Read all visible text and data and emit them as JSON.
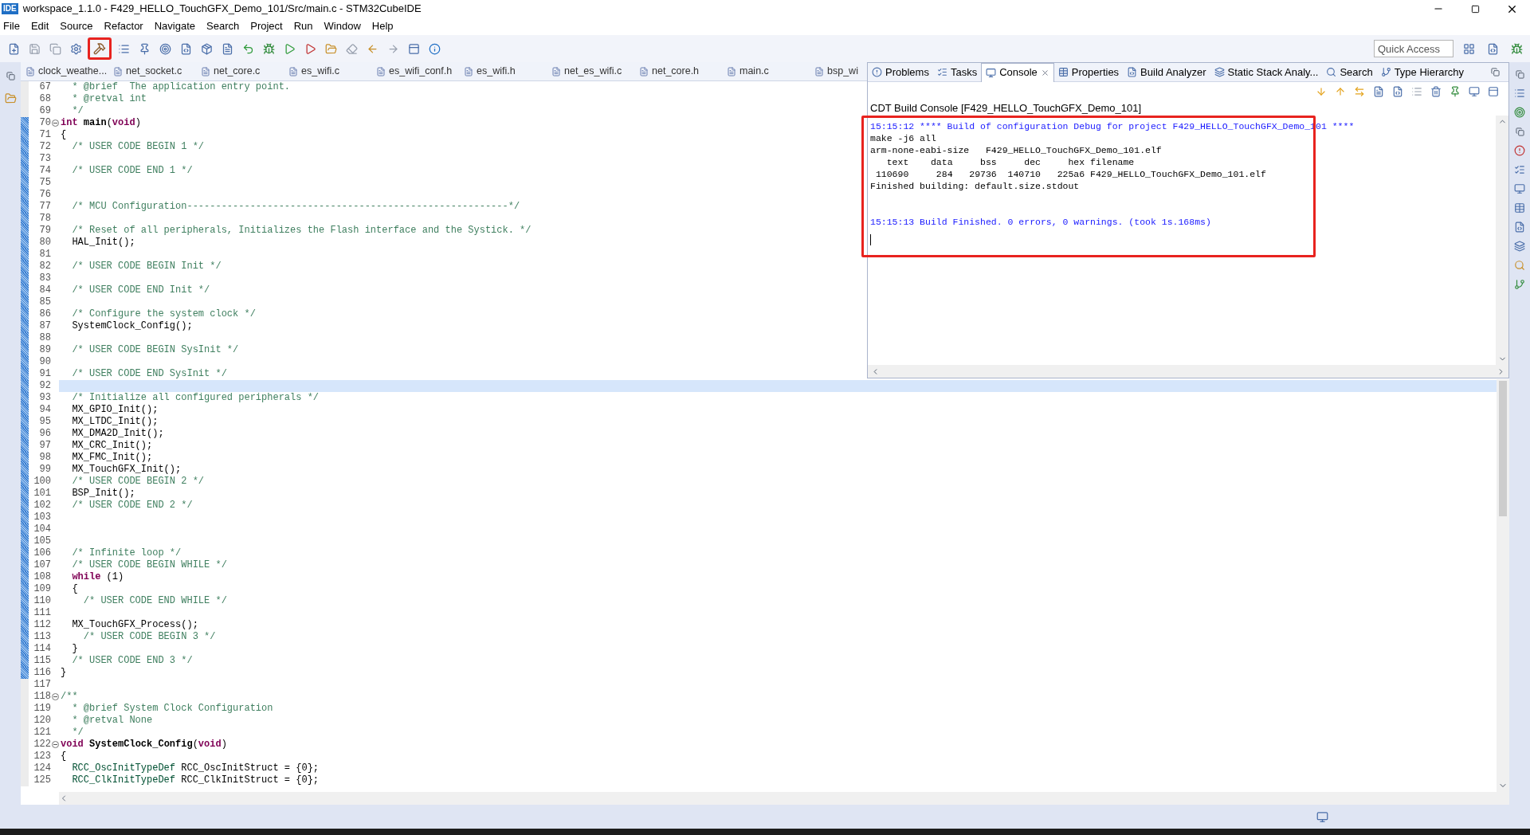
{
  "window": {
    "title": "workspace_1.1.0 - F429_HELLO_TouchGFX_Demo_101/Src/main.c - STM32CubeIDE",
    "app_badge": "IDE"
  },
  "menu": [
    "File",
    "Edit",
    "Source",
    "Refactor",
    "Navigate",
    "Search",
    "Project",
    "Run",
    "Window",
    "Help"
  ],
  "quick_access": {
    "placeholder": "Quick Access"
  },
  "editor_tabs": [
    "clock_weathe...",
    "net_socket.c",
    "net_core.c",
    "es_wifi.c",
    "es_wifi_conf.h",
    "es_wifi.h",
    "net_es_wifi.c",
    "net_core.h",
    "main.c",
    "bsp_wi"
  ],
  "lines": [
    {
      "n": "67",
      "changed": false,
      "current": false,
      "fold": false,
      "segs": [
        {
          "kind": "comment",
          "text": "  * @brief  The application entry point."
        }
      ]
    },
    {
      "n": "68",
      "changed": false,
      "current": false,
      "fold": false,
      "segs": [
        {
          "kind": "comment",
          "text": "  * @retval int"
        }
      ]
    },
    {
      "n": "69",
      "changed": false,
      "current": false,
      "fold": false,
      "segs": [
        {
          "kind": "comment",
          "text": "  */"
        }
      ]
    },
    {
      "n": "70",
      "changed": true,
      "current": false,
      "fold": true,
      "segs": [
        {
          "kind": "keyword",
          "text": "int "
        },
        {
          "kind": "bold",
          "text": "main"
        },
        {
          "kind": "plain",
          "text": "("
        },
        {
          "kind": "keyword",
          "text": "void"
        },
        {
          "kind": "plain",
          "text": ")"
        }
      ]
    },
    {
      "n": "71",
      "changed": true,
      "current": false,
      "fold": false,
      "segs": [
        {
          "kind": "plain",
          "text": "{"
        }
      ]
    },
    {
      "n": "72",
      "changed": true,
      "current": false,
      "fold": false,
      "segs": [
        {
          "kind": "comment",
          "text": "  /* USER CODE BEGIN 1 */"
        }
      ]
    },
    {
      "n": "73",
      "changed": true,
      "current": false,
      "fold": false
    },
    {
      "n": "74",
      "changed": true,
      "current": false,
      "fold": false,
      "segs": [
        {
          "kind": "comment",
          "text": "  /* USER CODE END 1 */"
        }
      ]
    },
    {
      "n": "75",
      "changed": true,
      "current": false,
      "fold": false
    },
    {
      "n": "76",
      "changed": true,
      "current": false,
      "fold": false
    },
    {
      "n": "77",
      "changed": true,
      "current": false,
      "fold": false,
      "segs": [
        {
          "kind": "comment",
          "text": "  /* MCU Configuration--------------------------------------------------------*/"
        }
      ]
    },
    {
      "n": "78",
      "changed": true,
      "current": false,
      "fold": false
    },
    {
      "n": "79",
      "changed": true,
      "current": false,
      "fold": false,
      "segs": [
        {
          "kind": "comment",
          "text": "  /* Reset of all peripherals, Initializes the Flash interface and the Systick. */"
        }
      ]
    },
    {
      "n": "80",
      "changed": true,
      "current": false,
      "fold": false,
      "segs": [
        {
          "kind": "plain",
          "text": "  HAL_Init();"
        }
      ]
    },
    {
      "n": "81",
      "changed": true,
      "current": false,
      "fold": false
    },
    {
      "n": "82",
      "changed": true,
      "current": false,
      "fold": false,
      "segs": [
        {
          "kind": "comment",
          "text": "  /* USER CODE BEGIN Init */"
        }
      ]
    },
    {
      "n": "83",
      "changed": true,
      "current": false,
      "fold": false
    },
    {
      "n": "84",
      "changed": true,
      "current": false,
      "fold": false,
      "segs": [
        {
          "kind": "comment",
          "text": "  /* USER CODE END Init */"
        }
      ]
    },
    {
      "n": "85",
      "changed": true,
      "current": false,
      "fold": false
    },
    {
      "n": "86",
      "changed": true,
      "current": false,
      "fold": false,
      "segs": [
        {
          "kind": "comment",
          "text": "  /* Configure the system clock */"
        }
      ]
    },
    {
      "n": "87",
      "changed": true,
      "current": false,
      "fold": false,
      "segs": [
        {
          "kind": "plain",
          "text": "  SystemClock_Config();"
        }
      ]
    },
    {
      "n": "88",
      "changed": true,
      "current": false,
      "fold": false
    },
    {
      "n": "89",
      "changed": true,
      "current": false,
      "fold": false,
      "segs": [
        {
          "kind": "comment",
          "text": "  /* USER CODE BEGIN SysInit */"
        }
      ]
    },
    {
      "n": "90",
      "changed": true,
      "current": false,
      "fold": false
    },
    {
      "n": "91",
      "changed": true,
      "current": false,
      "fold": false,
      "segs": [
        {
          "kind": "comment",
          "text": "  /* USER CODE END SysInit */"
        }
      ]
    },
    {
      "n": "92",
      "changed": true,
      "current": true,
      "fold": false
    },
    {
      "n": "93",
      "changed": true,
      "current": false,
      "fold": false,
      "segs": [
        {
          "kind": "comment",
          "text": "  /* Initialize all configured peripherals */"
        }
      ]
    },
    {
      "n": "94",
      "changed": true,
      "current": false,
      "fold": false,
      "segs": [
        {
          "kind": "plain",
          "text": "  MX_GPIO_Init();"
        }
      ]
    },
    {
      "n": "95",
      "changed": true,
      "current": false,
      "fold": false,
      "segs": [
        {
          "kind": "plain",
          "text": "  MX_LTDC_Init();"
        }
      ]
    },
    {
      "n": "96",
      "changed": true,
      "current": false,
      "fold": false,
      "segs": [
        {
          "kind": "plain",
          "text": "  MX_DMA2D_Init();"
        }
      ]
    },
    {
      "n": "97",
      "changed": true,
      "current": false,
      "fold": false,
      "segs": [
        {
          "kind": "plain",
          "text": "  MX_CRC_Init();"
        }
      ]
    },
    {
      "n": "98",
      "changed": true,
      "current": false,
      "fold": false,
      "segs": [
        {
          "kind": "plain",
          "text": "  MX_FMC_Init();"
        }
      ]
    },
    {
      "n": "99",
      "changed": true,
      "current": false,
      "fold": false,
      "segs": [
        {
          "kind": "plain",
          "text": "  MX_TouchGFX_Init();"
        }
      ]
    },
    {
      "n": "100",
      "changed": true,
      "current": false,
      "fold": false,
      "segs": [
        {
          "kind": "comment",
          "text": "  /* USER CODE BEGIN 2 */"
        }
      ]
    },
    {
      "n": "101",
      "changed": true,
      "current": false,
      "fold": false,
      "segs": [
        {
          "kind": "plain",
          "text": "  BSP_Init();"
        }
      ]
    },
    {
      "n": "102",
      "changed": true,
      "current": false,
      "fold": false,
      "segs": [
        {
          "kind": "comment",
          "text": "  /* USER CODE END 2 */"
        }
      ]
    },
    {
      "n": "103",
      "changed": true,
      "current": false,
      "fold": false
    },
    {
      "n": "104",
      "changed": true,
      "current": false,
      "fold": false
    },
    {
      "n": "105",
      "changed": true,
      "current": false,
      "fold": false
    },
    {
      "n": "106",
      "changed": true,
      "current": false,
      "fold": false,
      "segs": [
        {
          "kind": "comment",
          "text": "  /* Infinite loop */"
        }
      ]
    },
    {
      "n": "107",
      "changed": true,
      "current": false,
      "fold": false,
      "segs": [
        {
          "kind": "comment",
          "text": "  /* USER CODE BEGIN WHILE */"
        }
      ]
    },
    {
      "n": "108",
      "changed": true,
      "current": false,
      "fold": false,
      "segs": [
        {
          "kind": "keyword",
          "text": "  while"
        },
        {
          "kind": "plain",
          "text": " (1)"
        }
      ]
    },
    {
      "n": "109",
      "changed": true,
      "current": false,
      "fold": false,
      "segs": [
        {
          "kind": "plain",
          "text": "  {"
        }
      ]
    },
    {
      "n": "110",
      "changed": true,
      "current": false,
      "fold": false,
      "segs": [
        {
          "kind": "comment",
          "text": "    /* USER CODE END WHILE */"
        }
      ]
    },
    {
      "n": "111",
      "changed": true,
      "current": false,
      "fold": false
    },
    {
      "n": "112",
      "changed": true,
      "current": false,
      "fold": false,
      "segs": [
        {
          "kind": "plain",
          "text": "  MX_TouchGFX_Process();"
        }
      ]
    },
    {
      "n": "113",
      "changed": true,
      "current": false,
      "fold": false,
      "segs": [
        {
          "kind": "comment",
          "text": "    /* USER CODE BEGIN 3 */"
        }
      ]
    },
    {
      "n": "114",
      "changed": true,
      "current": false,
      "fold": false,
      "segs": [
        {
          "kind": "plain",
          "text": "  }"
        }
      ]
    },
    {
      "n": "115",
      "changed": true,
      "current": false,
      "fold": false,
      "segs": [
        {
          "kind": "comment",
          "text": "  /* USER CODE END 3 */"
        }
      ]
    },
    {
      "n": "116",
      "changed": true,
      "current": false,
      "fold": false,
      "segs": [
        {
          "kind": "plain",
          "text": "}"
        }
      ]
    },
    {
      "n": "117",
      "changed": false,
      "current": false,
      "fold": false
    },
    {
      "n": "118",
      "changed": false,
      "current": false,
      "fold": true,
      "segs": [
        {
          "kind": "comment",
          "text": "/**"
        }
      ]
    },
    {
      "n": "119",
      "changed": false,
      "current": false,
      "fold": false,
      "segs": [
        {
          "kind": "comment",
          "text": "  * @brief System Clock Configuration"
        }
      ]
    },
    {
      "n": "120",
      "changed": false,
      "current": false,
      "fold": false,
      "segs": [
        {
          "kind": "comment",
          "text": "  * @retval None"
        }
      ]
    },
    {
      "n": "121",
      "changed": false,
      "current": false,
      "fold": false,
      "segs": [
        {
          "kind": "comment",
          "text": "  */"
        }
      ]
    },
    {
      "n": "122",
      "changed": false,
      "current": false,
      "fold": true,
      "segs": [
        {
          "kind": "keyword",
          "text": "void "
        },
        {
          "kind": "bold",
          "text": "SystemClock_Config"
        },
        {
          "kind": "plain",
          "text": "("
        },
        {
          "kind": "keyword",
          "text": "void"
        },
        {
          "kind": "plain",
          "text": ")"
        }
      ]
    },
    {
      "n": "123",
      "changed": false,
      "current": false,
      "fold": false,
      "segs": [
        {
          "kind": "plain",
          "text": "{"
        }
      ]
    },
    {
      "n": "124",
      "changed": false,
      "current": false,
      "fold": false,
      "segs": [
        {
          "kind": "type",
          "text": "  RCC_OscInitTypeDef"
        },
        {
          "kind": "plain",
          "text": " RCC_OscInitStruct = {0};"
        }
      ]
    },
    {
      "n": "125",
      "changed": false,
      "current": false,
      "fold": false,
      "segs": [
        {
          "kind": "type",
          "text": "  RCC_ClkInitTypeDef"
        },
        {
          "kind": "plain",
          "text": " RCC_ClkInitStruct = {0};"
        }
      ]
    }
  ],
  "console_tabs": [
    {
      "label": "Problems",
      "selected": false
    },
    {
      "label": "Tasks",
      "selected": false
    },
    {
      "label": "Console",
      "selected": true
    },
    {
      "label": "Properties",
      "selected": false
    },
    {
      "label": "Build Analyzer",
      "selected": false
    },
    {
      "label": "Static Stack Analy...",
      "selected": false
    },
    {
      "label": "Search",
      "selected": false
    },
    {
      "label": "Type Hierarchy",
      "selected": false
    }
  ],
  "console_title": "CDT Build Console [F429_HELLO_TouchGFX_Demo_101]",
  "console_lines": [
    {
      "kind": "info",
      "text": "15:15:12 **** Build of configuration Debug for project F429_HELLO_TouchGFX_Demo_101 ****"
    },
    {
      "kind": "output",
      "text": "make -j6 all"
    },
    {
      "kind": "output",
      "text": "arm-none-eabi-size   F429_HELLO_TouchGFX_Demo_101.elf"
    },
    {
      "kind": "output",
      "text": "   text\t   data\t    bss\t    dec\t    hex filename"
    },
    {
      "kind": "output",
      "text": " 110690\t    284\t  29736\t 140710\t  225a6 F429_HELLO_TouchGFX_Demo_101.elf"
    },
    {
      "kind": "output",
      "text": "Finished building: default.size.stdout"
    },
    {
      "kind": "summary",
      "text": "15:15:13 Build Finished. 0 errors, 0 warnings. (took 1s.168ms)"
    }
  ]
}
